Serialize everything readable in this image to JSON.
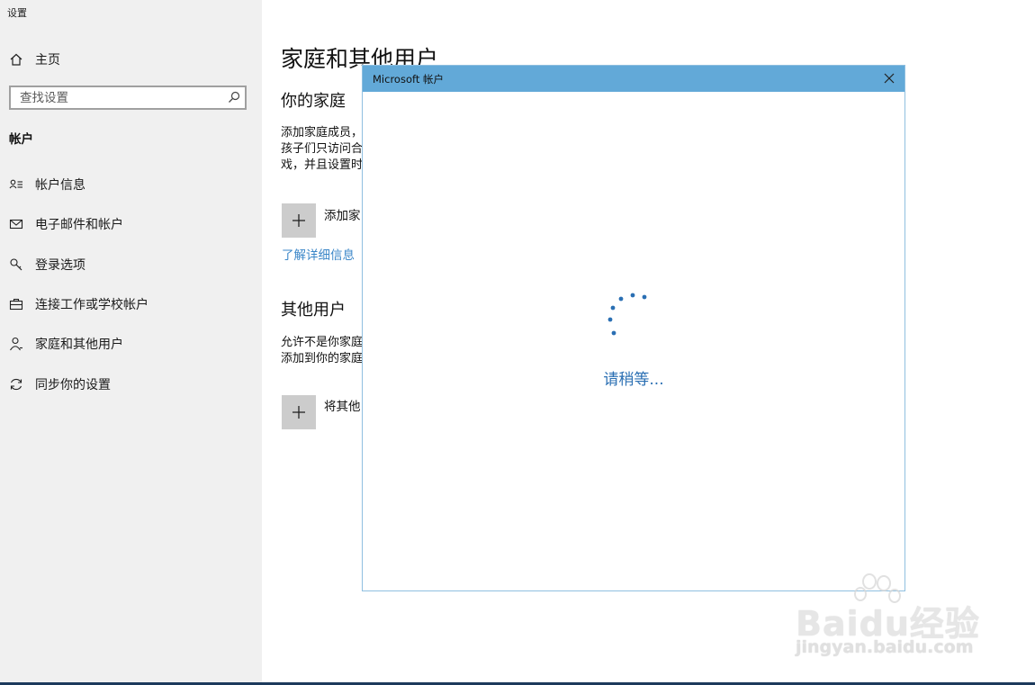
{
  "window": {
    "title": "设置"
  },
  "sidebar": {
    "home_label": "主页",
    "search": {
      "placeholder": "查找设置"
    },
    "section_heading": "帐户",
    "items": [
      {
        "label": "帐户信息",
        "icon": "account-info-icon"
      },
      {
        "label": "电子邮件和帐户",
        "icon": "mail-icon"
      },
      {
        "label": "登录选项",
        "icon": "key-icon"
      },
      {
        "label": "连接工作或学校帐户",
        "icon": "briefcase-icon"
      },
      {
        "label": "家庭和其他用户",
        "icon": "person-icon"
      },
      {
        "label": "同步你的设置",
        "icon": "sync-icon"
      }
    ],
    "active_item": "家庭和其他用户"
  },
  "main": {
    "title": "家庭和其他用户",
    "family": {
      "heading": "你的家庭",
      "description_lines": [
        "添加家庭成员，",
        "孩子们只访问合",
        "戏，并且设置时"
      ],
      "add_button_label": "添加家",
      "learn_more_link": "了解详细信息"
    },
    "others": {
      "heading": "其他用户",
      "description_lines": [
        "允许不是你家庭",
        "添加到你的家庭"
      ],
      "add_button_label": "将其他"
    }
  },
  "dialog": {
    "title": "Microsoft 帐户",
    "status_text": "请稍等..."
  },
  "watermark": {
    "brand": "Baidu经验",
    "url": "jingyan.baidu.com"
  },
  "colors": {
    "dialog_titlebar": "#62a9d8",
    "accent_link": "#3a86c8",
    "spinner": "#2a6fb3"
  }
}
